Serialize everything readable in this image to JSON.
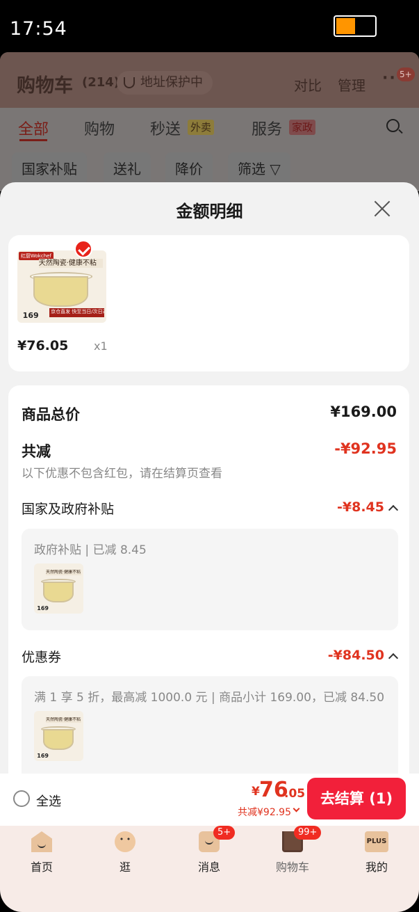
{
  "status_bar": {
    "time": "17:54"
  },
  "background_app": {
    "title": "购物车",
    "count": "(214)",
    "address_protection": "地址保护中",
    "compare": "对比",
    "manage": "管理",
    "more_badge": "5+",
    "tabs": [
      {
        "label": "全部"
      },
      {
        "label": "购物"
      },
      {
        "label": "秒送",
        "tag": "外卖"
      },
      {
        "label": "服务",
        "tag": "家政"
      }
    ],
    "filters": [
      "国家补贴",
      "送礼",
      "降价",
      "筛选"
    ]
  },
  "sheet": {
    "title": "金额明细",
    "product": {
      "price": "¥76.05",
      "quantity": "x1",
      "thumb_brand": "红厨Wokchef",
      "thumb_banner": "天然陶瓷·健康不粘",
      "thumb_price": "169",
      "thumb_delivery": "京仓直发 快至当日/次日达"
    },
    "total_label": "商品总价",
    "total_value": "¥169.00",
    "discount_label": "共减",
    "discount_value": "-¥92.95",
    "discount_note": "以下优惠不包含红包，请在结算页查看",
    "subsidy": {
      "label": "国家及政府补贴",
      "value": "-¥8.45",
      "detail": "政府补贴 | 已减 8.45"
    },
    "coupon": {
      "label": "优惠券",
      "value": "-¥84.50",
      "detail": "满 1 享 5 折，最高减 1000.0 元 | 商品小计 169.00，已减 84.50"
    }
  },
  "checkout": {
    "select_all": "全选",
    "currency": "¥",
    "total_int": "76",
    "total_dec": ".05",
    "saved": "共减¥92.95",
    "button": "去结算 (1)"
  },
  "tabbar": {
    "items": [
      {
        "label": "首页"
      },
      {
        "label": "逛"
      },
      {
        "label": "消息",
        "badge": "5+"
      },
      {
        "label": "购物车",
        "badge": "99+"
      },
      {
        "label": "我的",
        "icon_text": "PLUS"
      }
    ]
  },
  "colors": {
    "accent": "#f2203a",
    "discount": "#e0331f",
    "sheet_bg": "#f2f2f2"
  }
}
